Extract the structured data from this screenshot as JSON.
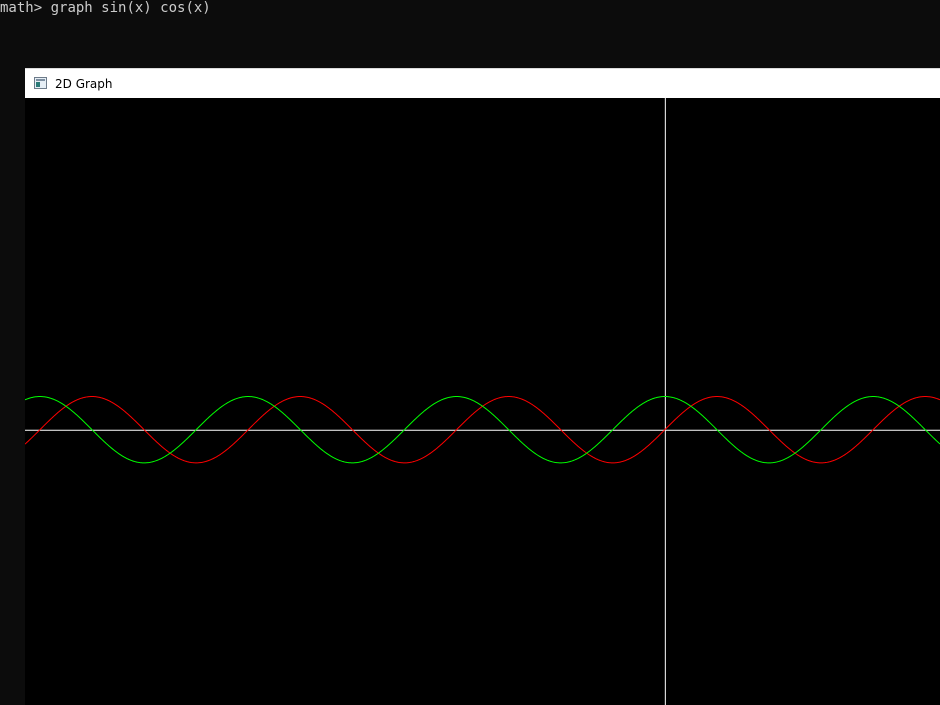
{
  "terminal": {
    "prompt": "math>",
    "command": "graph sin(x) cos(x)"
  },
  "window": {
    "title": "2D Graph",
    "icon": "application-window-icon"
  },
  "colors": {
    "background": "#000000",
    "axes": "#ffffff",
    "sin": "#ff0000",
    "cos": "#00ff00"
  },
  "chart_data": {
    "type": "line",
    "title": "",
    "xlabel": "",
    "ylabel": "",
    "grid": false,
    "xlim": [
      -19.3,
      8.3
    ],
    "ylim": [
      -8.3,
      10.0
    ],
    "series": [
      {
        "function": "sin(x)",
        "color": "#ff0000"
      },
      {
        "function": "cos(x)",
        "color": "#00ff00"
      }
    ]
  }
}
